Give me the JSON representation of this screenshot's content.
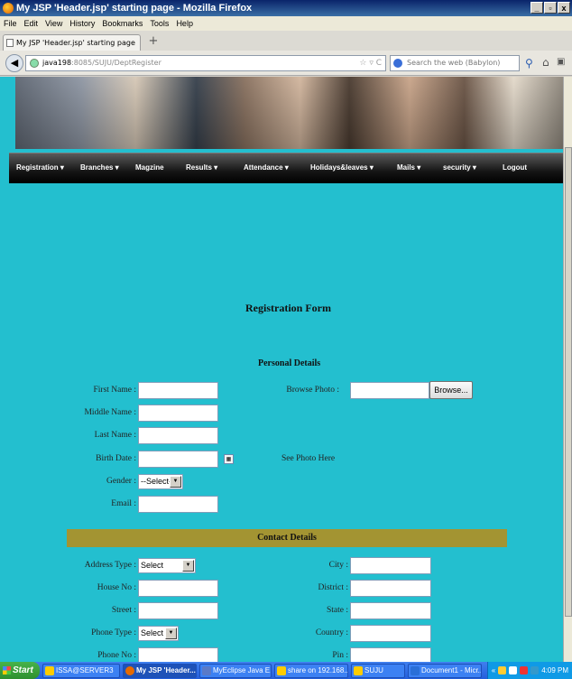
{
  "window": {
    "title": "My JSP 'Header.jsp' starting page - Mozilla Firefox",
    "controls": [
      "_",
      "▫",
      "x"
    ]
  },
  "menubar": [
    "File",
    "Edit",
    "View",
    "History",
    "Bookmarks",
    "Tools",
    "Help"
  ],
  "tab": {
    "label": "My JSP 'Header.jsp' starting page",
    "new_tab": "+"
  },
  "navbar": {
    "url_host": "java198",
    "url_rest": ":8085/SUJU/DeptRegister",
    "url_icons": "☆ ▿ C",
    "search_placeholder": "Search the web (Babylon)"
  },
  "site_nav": [
    "Registration ▾",
    "Branches ▾",
    "Magzine",
    "Results ▾",
    "Attendance ▾",
    "Holidays&leaves ▾",
    "Mails ▾",
    "security ▾",
    "Logout"
  ],
  "form": {
    "title": "Registration Form",
    "personal_heading": "Personal Details",
    "labels": {
      "first_name": "First Name :",
      "middle_name": "Middle Name :",
      "last_name": "Last Name :",
      "birth_date": "Birth Date :",
      "gender": "Gender :",
      "email": "Email :",
      "browse_photo": "Browse Photo :"
    },
    "gender_value": "--Select--",
    "browse_button": "Browse...",
    "photo_placeholder": "See Photo Here",
    "contact_heading": "Contact Details",
    "contact_labels": {
      "address_type": "Address Type :",
      "house_no": "House No :",
      "street": "Street :",
      "phone_type": "Phone Type :",
      "phone_no": "Phone No :",
      "city": "City :",
      "district": "District :",
      "state": "State :",
      "country": "Country :",
      "pin": "Pin :"
    },
    "address_type_value": "Select",
    "phone_type_value": "Select"
  },
  "taskbar": {
    "start": "Start",
    "tasks": [
      "ISSA@SERVER3",
      "My JSP 'Header...",
      "MyEclipse Java E...",
      "share on 192.168....",
      "SUJU",
      "Document1 - Micr..."
    ],
    "clock": "4:09 PM"
  },
  "colors": {
    "page_background": "#23bfcf",
    "contact_bar": "#a39432",
    "nav_bar": "#151515"
  }
}
